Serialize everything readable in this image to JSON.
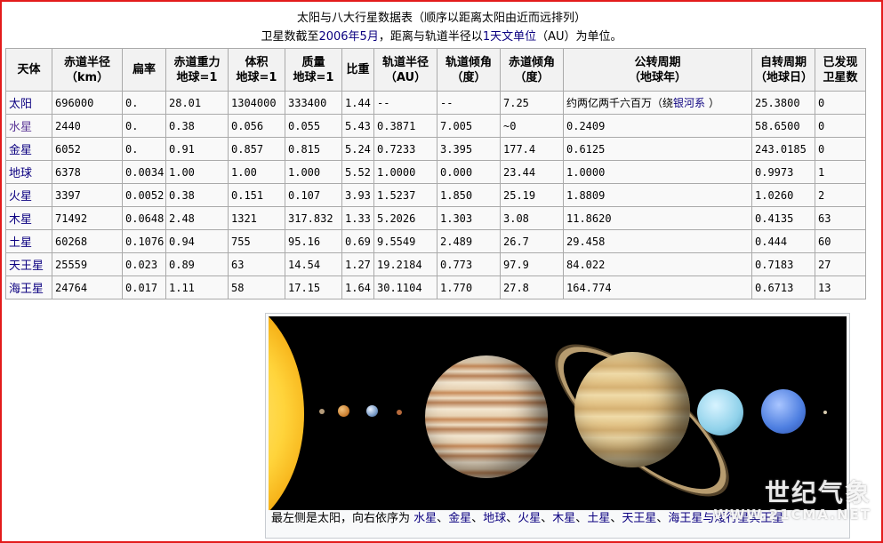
{
  "caption": {
    "title": "太阳与八大行星数据表（顺序以距离太阳由近而远排列）",
    "line2_a": "卫星数截至",
    "line2_link": "2006年5月",
    "line2_b": "，距离与轨道半径以",
    "line2_link2": "1天文单位",
    "line2_c": "（AU）为单位。"
  },
  "table": {
    "headers": [
      [
        "天体",
        ""
      ],
      [
        "赤道半径",
        "（km）"
      ],
      [
        "扁率",
        ""
      ],
      [
        "赤道重力",
        "地球=1"
      ],
      [
        "体积",
        "地球=1"
      ],
      [
        "质量",
        "地球=1"
      ],
      [
        "比重",
        ""
      ],
      [
        "轨道半径",
        "（AU）"
      ],
      [
        "轨道倾角",
        "（度）"
      ],
      [
        "赤道倾角",
        "（度）"
      ],
      [
        "公转周期",
        "（地球年）"
      ],
      [
        "自转周期",
        "（地球日）"
      ],
      [
        "已发现",
        "卫星数"
      ]
    ],
    "rows": [
      {
        "name": "太阳",
        "cells": [
          "696000",
          "0.",
          "28.01",
          "1304000",
          "333400",
          "1.44",
          "--",
          "--",
          "7.25",
          "约两亿两千六百万（绕",
          "25.3800",
          "0"
        ],
        "rev_link": "银河系",
        "rev_tail": "）"
      },
      {
        "name": "水星",
        "cells": [
          "2440",
          "0.",
          "0.38",
          "0.056",
          "0.055",
          "5.43",
          "0.3871",
          "7.005",
          "~0",
          "0.2409",
          "58.6500",
          "0"
        ]
      },
      {
        "name": "金星",
        "cells": [
          "6052",
          "0.",
          "0.91",
          "0.857",
          "0.815",
          "5.24",
          "0.7233",
          "3.395",
          "177.4",
          "0.6125",
          "243.0185",
          "0"
        ]
      },
      {
        "name": "地球",
        "cells": [
          "6378",
          "0.0034",
          "1.00",
          "1.00",
          "1.000",
          "5.52",
          "1.0000",
          "0.000",
          "23.44",
          "1.0000",
          "0.9973",
          "1"
        ]
      },
      {
        "name": "火星",
        "cells": [
          "3397",
          "0.0052",
          "0.38",
          "0.151",
          "0.107",
          "3.93",
          "1.5237",
          "1.850",
          "25.19",
          "1.8809",
          "1.0260",
          "2"
        ]
      },
      {
        "name": "木星",
        "cells": [
          "71492",
          "0.0648",
          "2.48",
          "1321",
          "317.832",
          "1.33",
          "5.2026",
          "1.303",
          "3.08",
          "11.8620",
          "0.4135",
          "63"
        ]
      },
      {
        "name": "土星",
        "cells": [
          "60268",
          "0.1076",
          "0.94",
          "755",
          "95.16",
          "0.69",
          "9.5549",
          "2.489",
          "26.7",
          "29.458",
          "0.444",
          "60"
        ]
      },
      {
        "name": "天王星",
        "cells": [
          "25559",
          "0.023",
          "0.89",
          "63",
          "14.54",
          "1.27",
          "19.2184",
          "0.773",
          "97.9",
          "84.022",
          "0.7183",
          "27"
        ]
      },
      {
        "name": "海王星",
        "cells": [
          "24764",
          "0.017",
          "1.11",
          "58",
          "17.15",
          "1.64",
          "30.1104",
          "1.770",
          "27.8",
          "164.774",
          "0.6713",
          "13"
        ]
      }
    ]
  },
  "figure": {
    "caption_prefix": "最左侧是太阳，向右依序为",
    "planets": [
      "水星",
      "金星",
      "地球",
      "火星",
      "木星",
      "土星",
      "天王星",
      "海王星"
    ],
    "caption_tail": "与矮行星冥王星",
    "separator": "、"
  },
  "watermark": {
    "line1": "世纪气象",
    "line2": "WWW.21CMA.NET"
  },
  "colors": {
    "link": "#0b0080",
    "border": "#aaaaaa",
    "header_bg": "#f2f2f2",
    "frame": "#e31b1b"
  }
}
